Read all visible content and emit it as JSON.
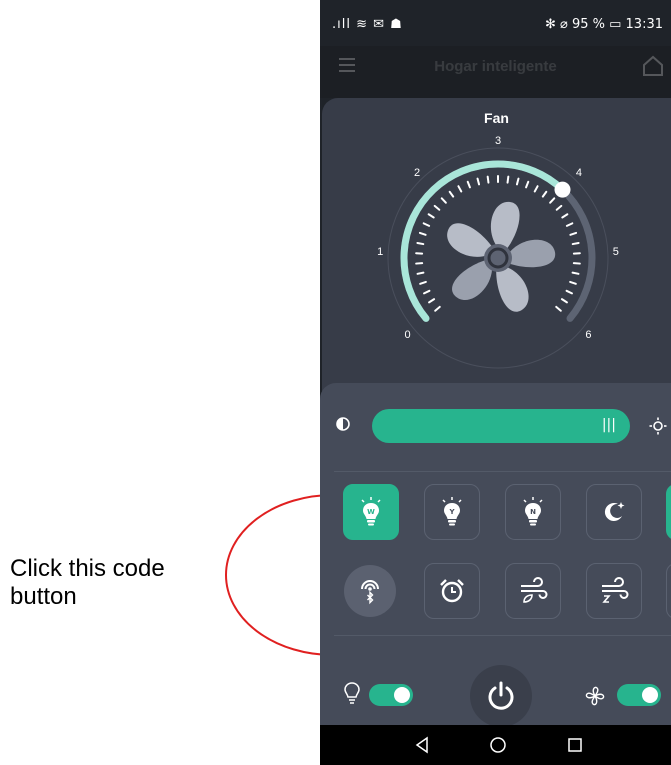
{
  "annotation": {
    "text": "Click this code\n button",
    "color": "#e02020"
  },
  "statusbar": {
    "left_icons": ".ıll ≋ ✉ ☗",
    "right_text": "✻ ⌀ 95 % ▭ 13:31",
    "battery_percent": "95 %",
    "time": "13:31"
  },
  "appbar": {
    "title": "Hogar inteligente",
    "menu_icon": "menu-icon",
    "home_icon": "home-icon"
  },
  "fan_dial": {
    "title": "Fan",
    "scale_labels": [
      "0",
      "1",
      "2",
      "3",
      "4",
      "5",
      "6"
    ],
    "current_level": 4,
    "max_level": 6,
    "accent": "#a9e6d9"
  },
  "brightness": {
    "min_icon": "contrast-icon",
    "max_icon": "sun-icon",
    "level_percent": 100,
    "grip": "|||"
  },
  "modes_row1": [
    {
      "name": "bulb-w",
      "letter": "W",
      "active": true
    },
    {
      "name": "bulb-y",
      "letter": "Y",
      "active": false
    },
    {
      "name": "bulb-n",
      "letter": "N",
      "active": false
    },
    {
      "name": "moon",
      "letter": "",
      "active": false
    }
  ],
  "modes_row2": [
    {
      "name": "bluetooth-code",
      "active": false
    },
    {
      "name": "alarm-clock",
      "active": false
    },
    {
      "name": "wind-eco",
      "active": false
    },
    {
      "name": "wind-sleep",
      "active": false
    }
  ],
  "bottom": {
    "light_toggle_on": true,
    "fan_toggle_on": true,
    "power_icon": "power-icon"
  },
  "colors": {
    "accent": "#27b48e",
    "card": "#373c48",
    "panel": "#454b59",
    "background": "#1f2329"
  }
}
